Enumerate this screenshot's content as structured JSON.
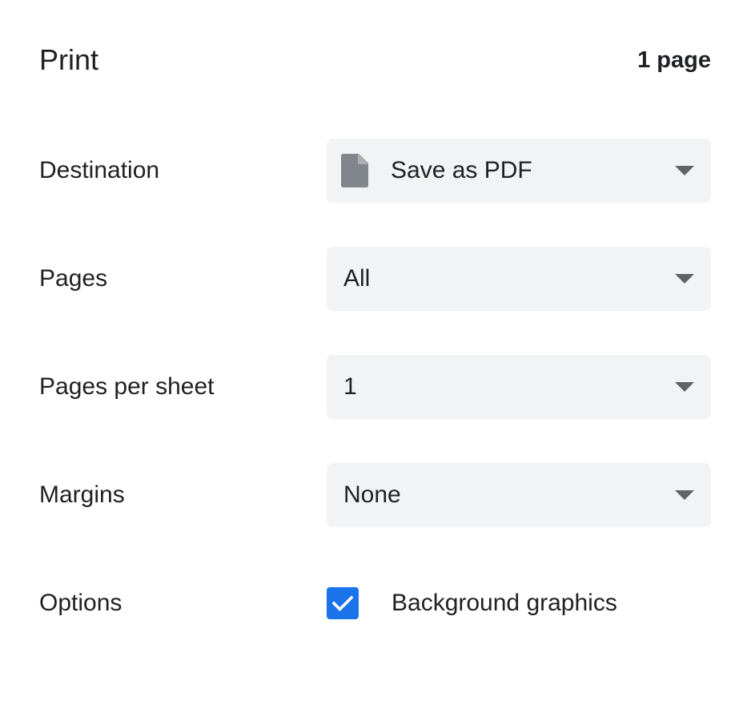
{
  "header": {
    "title": "Print",
    "page_count": "1 page"
  },
  "destination": {
    "label": "Destination",
    "value": "Save as PDF",
    "icon": "file-icon"
  },
  "pages": {
    "label": "Pages",
    "value": "All"
  },
  "pages_per_sheet": {
    "label": "Pages per sheet",
    "value": "1"
  },
  "margins": {
    "label": "Margins",
    "value": "None"
  },
  "options": {
    "label": "Options",
    "background_graphics": {
      "label": "Background graphics",
      "checked": true
    }
  },
  "colors": {
    "accent": "#1a73e8",
    "select_bg": "#f1f3f4",
    "text": "#202124",
    "icon_gray": "#80868b"
  }
}
